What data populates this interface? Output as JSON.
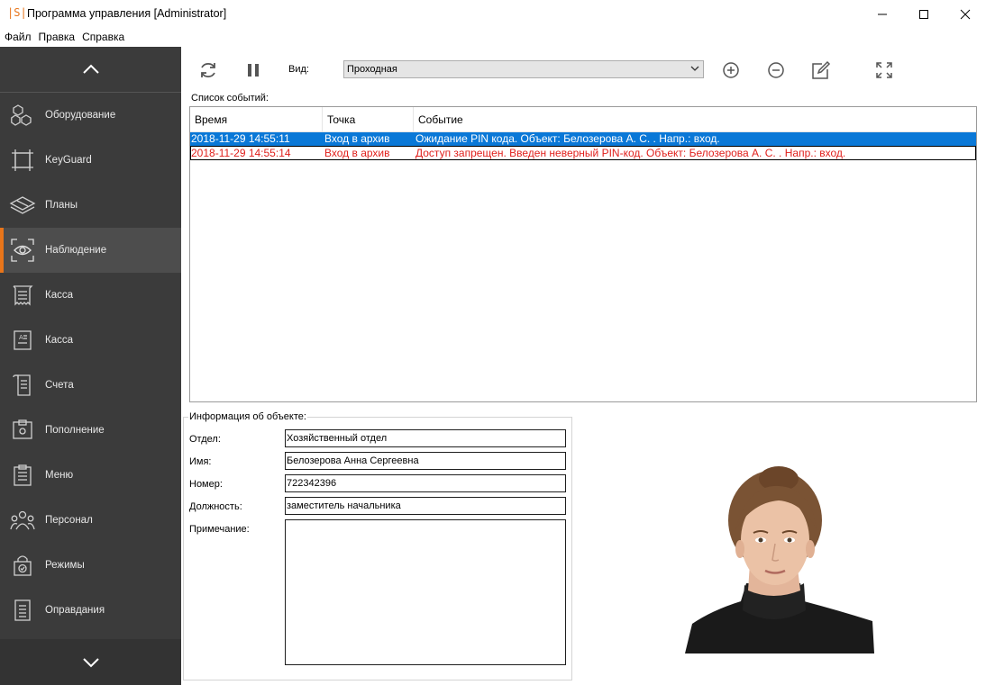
{
  "window": {
    "icon_text": "|S|",
    "title": "Программа управления [Administrator]"
  },
  "menu": [
    "Файл",
    "Правка",
    "Справка"
  ],
  "sidebar": {
    "items": [
      {
        "label": "Оборудование",
        "icon": "equipment-icon"
      },
      {
        "label": "KeyGuard",
        "icon": "keyguard-icon"
      },
      {
        "label": "Планы",
        "icon": "plans-icon"
      },
      {
        "label": "Наблюдение",
        "icon": "eye-icon",
        "active": true
      },
      {
        "label": "Касса",
        "icon": "receipt-icon"
      },
      {
        "label": "Касса",
        "icon": "register-icon"
      },
      {
        "label": "Счета",
        "icon": "bill-icon"
      },
      {
        "label": "Пополнение",
        "icon": "topup-icon"
      },
      {
        "label": "Меню",
        "icon": "menu-clipboard-icon"
      },
      {
        "label": "Персонал",
        "icon": "people-icon"
      },
      {
        "label": "Режимы",
        "icon": "lock-icon"
      },
      {
        "label": "Оправдания",
        "icon": "document-icon"
      }
    ]
  },
  "toolbar": {
    "view_label": "Вид:",
    "view_value": "Проходная"
  },
  "events": {
    "title": "Список событий:",
    "columns": [
      "Время",
      "Точка",
      "Событие"
    ],
    "rows": [
      {
        "time": "2018-11-29 14:55:11",
        "point": "Вход в архив",
        "event": "Ожидание PIN кода. Объект: Белозерова А. С. . Напр.: вход."
      },
      {
        "time": "2018-11-29 14:55:14",
        "point": "Вход в архив",
        "event": "Доступ запрещен. Введен неверный PIN-код. Объект: Белозерова А. С. . Напр.: вход."
      }
    ]
  },
  "info": {
    "title": "Информация об объекте:",
    "department_label": "Отдел:",
    "department_value": "Хозяйственный отдел",
    "name_label": "Имя:",
    "name_value": "Белозерова Анна Сергеевна",
    "number_label": "Номер:",
    "number_value": "722342396",
    "position_label": "Должность:",
    "position_value": "заместитель начальника",
    "note_label": "Примечание:",
    "note_value": ""
  },
  "colors": {
    "accent": "#e8751a",
    "sidebar_bg": "#3b3b3b",
    "selection": "#0a78d7",
    "error_text": "#e0201c"
  }
}
